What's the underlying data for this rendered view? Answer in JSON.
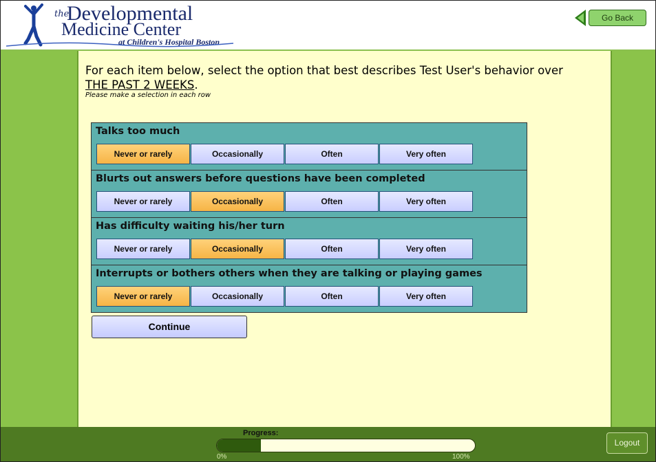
{
  "header": {
    "logo": {
      "the": "the",
      "line1": "Developmental",
      "line2": "Medicine Center",
      "line3": "at Children's Hospital Boston"
    },
    "go_back_label": "Go Back"
  },
  "instructions": {
    "text_before": "For each item below, select the option that best describes Test User's behavior over ",
    "emphasis": "THE PAST 2 WEEKS",
    "text_after": ".",
    "sub": "Please make a selection in each row"
  },
  "questions": [
    {
      "title": "Talks too much",
      "options": [
        "Never or rarely",
        "Occasionally",
        "Often",
        "Very often"
      ],
      "selected": 0
    },
    {
      "title": "Blurts out answers before questions have been completed",
      "options": [
        "Never or rarely",
        "Occasionally",
        "Often",
        "Very often"
      ],
      "selected": 1
    },
    {
      "title": "Has difficulty waiting his/her turn",
      "options": [
        "Never or rarely",
        "Occasionally",
        "Often",
        "Very often"
      ],
      "selected": 1
    },
    {
      "title": "Interrupts or bothers others when they are talking or playing games",
      "options": [
        "Never or rarely",
        "Occasionally",
        "Often",
        "Very often"
      ],
      "selected": 0
    }
  ],
  "continue_label": "Continue",
  "footer": {
    "progress_label": "Progress:",
    "progress_fraction": 0.17,
    "min_label": "0%",
    "max_label": "100%",
    "logout_label": "Logout"
  },
  "colors": {
    "band_green": "#8bc34a",
    "content_bg": "#ffffcc",
    "question_bg": "#5db0ad",
    "option_bg": "#d0d4ff",
    "option_selected": "#f8bf55",
    "footer_green": "#4e7a22",
    "progress_fill": "#2f5a0d"
  },
  "icons": {
    "logo_figure": "jumping-child-icon",
    "go_back": "left-arrow-icon"
  }
}
